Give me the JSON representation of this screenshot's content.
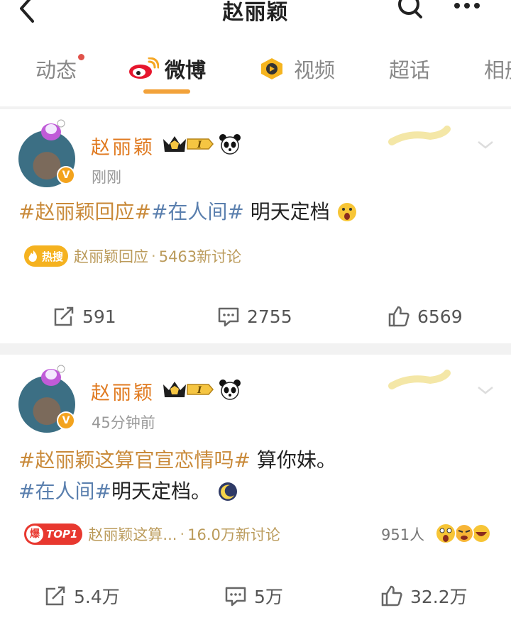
{
  "header": {
    "title": "赵丽颖",
    "back_icon": "chevron-left-icon",
    "search_icon": "search-icon",
    "more_icon": "more-horizontal-icon"
  },
  "tabs": [
    {
      "label": "动态",
      "icon": "",
      "active": false,
      "has_dot": true
    },
    {
      "label": "微博",
      "icon": "weibo-logo-icon",
      "active": true,
      "has_dot": false
    },
    {
      "label": "视频",
      "icon": "video-icon",
      "active": false,
      "has_dot": false
    },
    {
      "label": "超话",
      "icon": "",
      "active": false,
      "has_dot": false
    },
    {
      "label": "相册",
      "icon": "",
      "active": false,
      "has_dot": false
    }
  ],
  "posts": [
    {
      "username": "赵丽颖",
      "level_badge": "I",
      "time": "刚刚",
      "hashtag1": "#赵丽颖回应#",
      "hashtag2": "#在人间#",
      "text": " 明天定档",
      "hot_badge": "热搜",
      "hot_topic": "赵丽颖回应",
      "hot_count": "5463新讨论",
      "repost": "591",
      "comment": "2755",
      "like": "6569"
    },
    {
      "username": "赵丽颖",
      "level_badge": "I",
      "time": "45分钟前",
      "hashtag1": "#赵丽颖这算官宣恋情吗#",
      "text1": " 算你妹。",
      "hashtag2": "#在人间#",
      "text2": "明天定档。",
      "hot_badge_char": "爆",
      "hot_badge": "TOP1",
      "hot_topic": "赵丽颖这算...",
      "hot_count": "16.0万新讨论",
      "readers": "951人",
      "repost": "5.4万",
      "comment": "5万",
      "like": "32.2万"
    }
  ],
  "colors": {
    "accent": "#f2a23a",
    "username": "#e07a20",
    "hashtag_gold": "#c98a3a",
    "hashtag_blue": "#5a7fae",
    "hot_text": "#bb9b5b",
    "verified": "#f3a31d"
  }
}
